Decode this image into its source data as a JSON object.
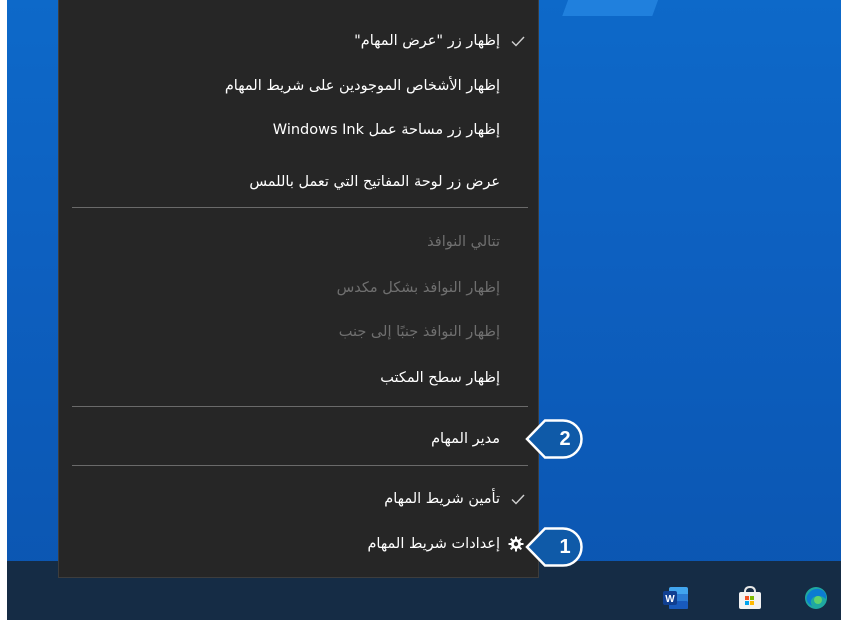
{
  "menu": {
    "items": [
      {
        "label": "إظهار زر \"عرض المهام\"",
        "checked": true,
        "disabled": false
      },
      {
        "label": "إظهار الأشخاص الموجودين على شريط المهام",
        "checked": false,
        "disabled": false
      },
      {
        "label": "إظهار زر مساحة عمل Windows Ink",
        "checked": false,
        "disabled": false
      },
      {
        "label": "عرض زر لوحة المفاتيح التي تعمل باللمس",
        "checked": false,
        "disabled": false
      },
      {
        "label": "تتالي النوافذ",
        "checked": false,
        "disabled": true
      },
      {
        "label": "إظهار النوافذ بشكل مكدس",
        "checked": false,
        "disabled": true
      },
      {
        "label": "إظهار النوافذ جنبًا إلى جنب",
        "checked": false,
        "disabled": true
      },
      {
        "label": "إظهار سطح المكتب",
        "checked": false,
        "disabled": false
      },
      {
        "label": "مدير المهام",
        "checked": false,
        "disabled": false
      },
      {
        "label": "تأمين شريط المهام",
        "checked": true,
        "disabled": false
      },
      {
        "label": "إعدادات شريط المهام",
        "checked": false,
        "disabled": false,
        "icon": "gear-icon"
      }
    ]
  },
  "callouts": [
    {
      "number": "2",
      "target": "مدير المهام"
    },
    {
      "number": "1",
      "target": "إعدادات شريط المهام"
    }
  ],
  "taskbar": {
    "icons": [
      "word-icon",
      "store-icon",
      "edge-icon"
    ]
  },
  "colors": {
    "desktop": "#0d5fbf",
    "menu_bg": "#262626",
    "callout_fill": "#0f5aa8",
    "callout_border": "#ffffff",
    "taskbar": "#152c45"
  }
}
